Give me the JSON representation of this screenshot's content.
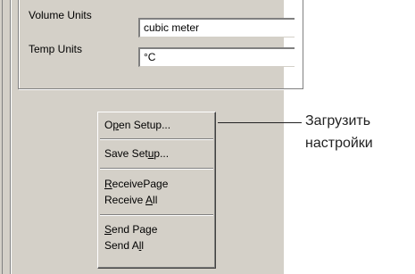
{
  "form": {
    "volume_units": {
      "label": "Volume Units",
      "value": "cubic meter"
    },
    "temp_units": {
      "label": "Temp Units",
      "value": "°C"
    }
  },
  "context_menu": {
    "items": [
      {
        "id": "open-setup",
        "before": "O",
        "mnemonic": "p",
        "after": "en Setup..."
      },
      {
        "id": "save-setup",
        "before": "Save Set",
        "mnemonic": "u",
        "after": "p..."
      },
      {
        "id": "receive-page",
        "before": "",
        "mnemonic": "R",
        "after": "eceivePage"
      },
      {
        "id": "receive-all",
        "before": "Receive ",
        "mnemonic": "A",
        "after": "ll"
      },
      {
        "id": "send-page",
        "before": "",
        "mnemonic": "S",
        "after": "end Page"
      },
      {
        "id": "send-all",
        "before": "Send A",
        "mnemonic": "l",
        "after": "l"
      }
    ]
  },
  "annotation": {
    "line1": "Загрузить",
    "line2": "настройки"
  }
}
